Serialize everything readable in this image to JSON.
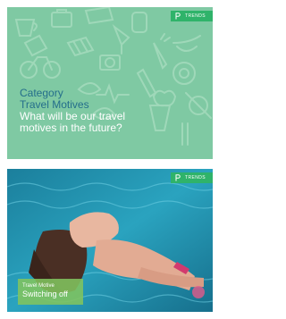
{
  "cards": [
    {
      "badge": "TRENDS",
      "category": "Category",
      "heading": "Travel Motives",
      "question_line1": "What will be our travel",
      "question_line2": "motives in the future?",
      "background_color": "#7fc9a3",
      "accent_color": "#246e8b"
    },
    {
      "badge": "TRENDS",
      "label": "Travel Motive",
      "title": "Switching off",
      "label_color": "#81c45e",
      "image": "woman-floating-in-pool"
    }
  ]
}
